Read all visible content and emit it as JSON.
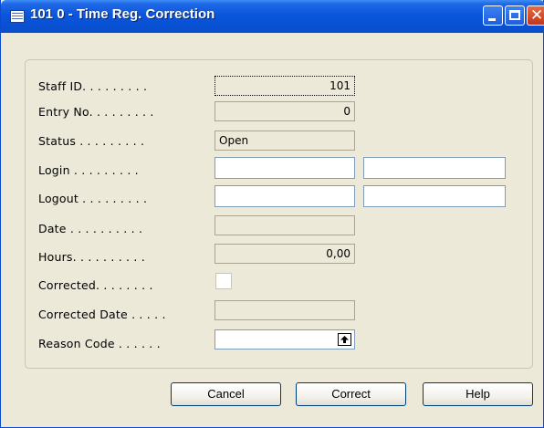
{
  "window": {
    "title": "101 0 - Time Reg. Correction",
    "icon": "form-icon",
    "controls": [
      "minimize",
      "maximize",
      "close"
    ],
    "close_glyph": "✕"
  },
  "fields": [
    {
      "label": "Staff ID. . . . . . . . .",
      "value": "101"
    },
    {
      "label": "Entry No. . . . . . . . .",
      "value": "0"
    },
    {
      "label": "Status . . . . . . . . .",
      "value": "Open"
    },
    {
      "label": "Login . . . . . . . . .",
      "value": "",
      "value2": ""
    },
    {
      "label": "Logout . . . . . . . . .",
      "value": "",
      "value2": ""
    },
    {
      "label": "Date . . . . . . . . . .",
      "value": ""
    },
    {
      "label": "Hours. . . . . . . . . .",
      "value": "0,00"
    },
    {
      "label": "Corrected. . . . . . . .",
      "checked": false
    },
    {
      "label": "Corrected Date . . . . .",
      "value": ""
    },
    {
      "label": "Reason Code . . . . . .",
      "value": "",
      "lookup_icon": "lookup-arrow-icon"
    }
  ],
  "buttons": {
    "cancel": "Cancel",
    "correct": "Correct",
    "help": "Help"
  },
  "colors": {
    "titlebar": "#0a55db",
    "dialog_bg": "#ece9d8",
    "close_button": "#c2361b"
  }
}
